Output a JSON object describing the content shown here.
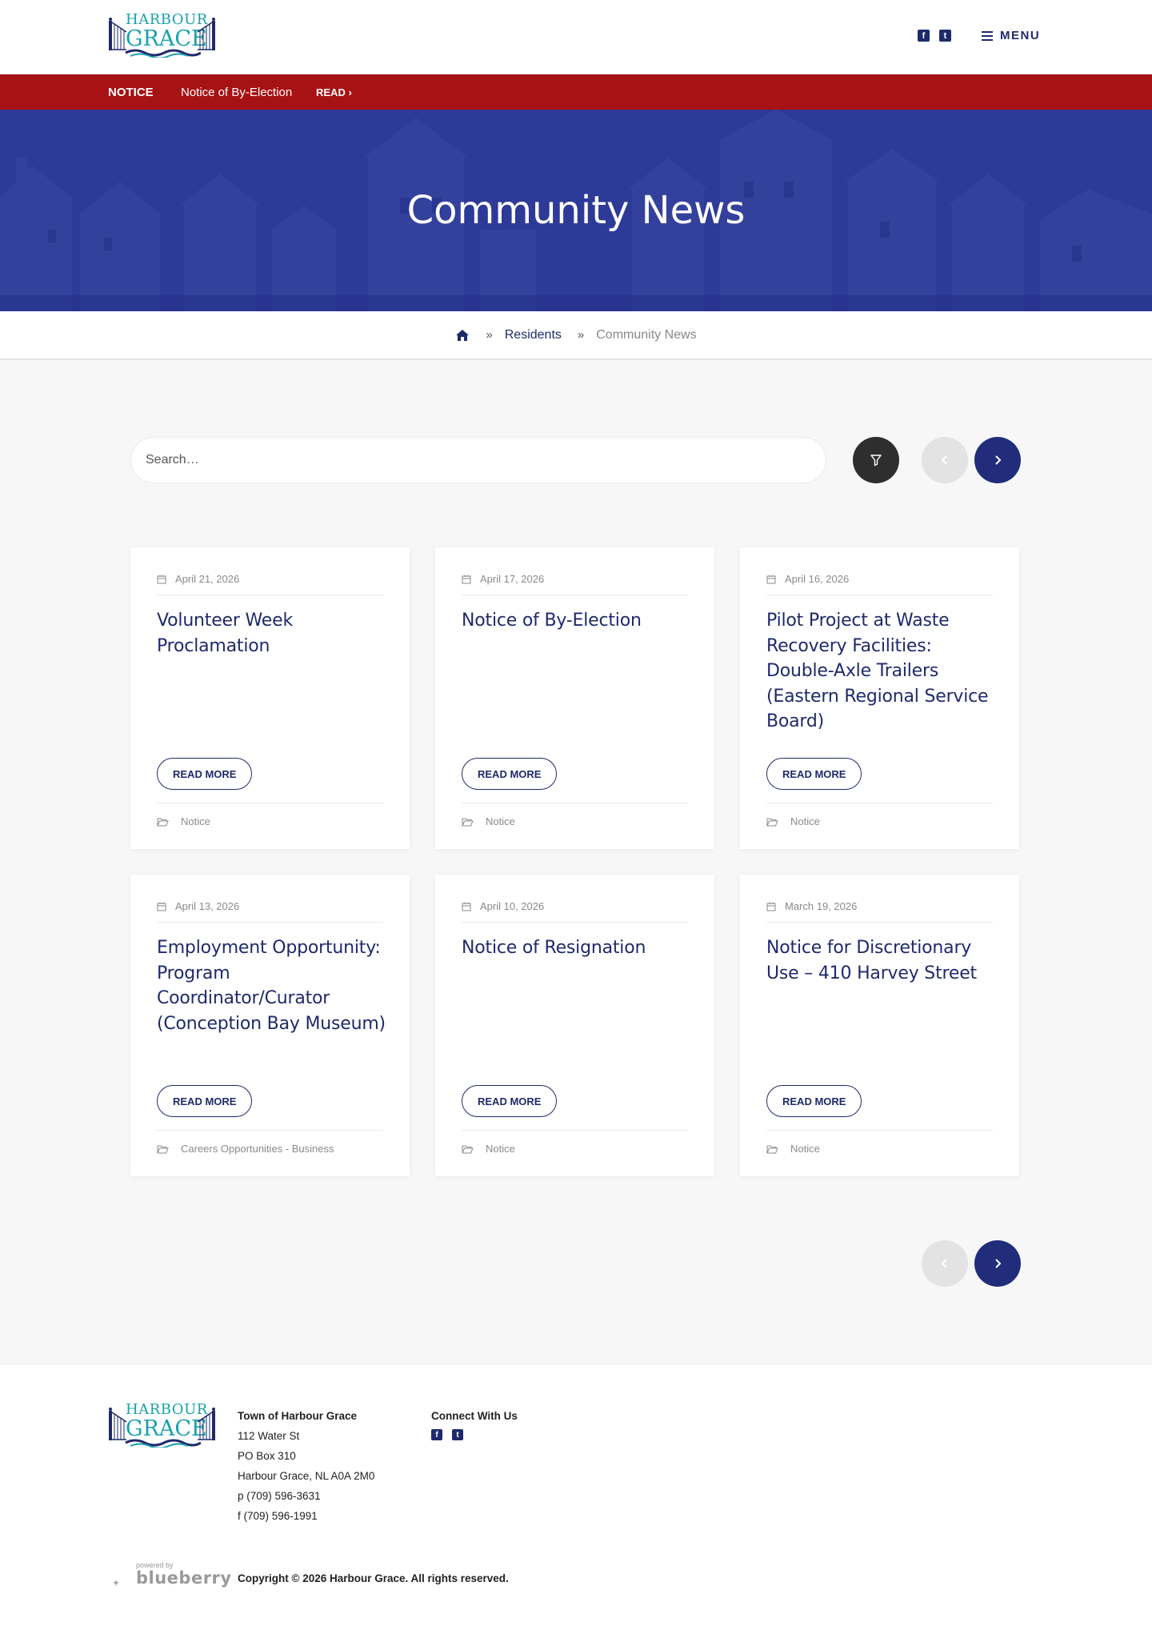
{
  "brand": {
    "logo_top": "HARBOUR",
    "logo_bottom": "GRACE",
    "accent": "#1aa0ad",
    "navy": "#1f2a6b"
  },
  "header": {
    "social": [
      {
        "icon": "facebook-icon",
        "glyph": "f"
      },
      {
        "icon": "twitter-icon",
        "glyph": "t"
      }
    ],
    "menu_label": "MENU"
  },
  "notice": {
    "label": "NOTICE",
    "text": "Notice of By-Election",
    "read_label": "READ ›",
    "color": "#a71214"
  },
  "hero": {
    "title": "Community News",
    "color": "#2d3a97"
  },
  "breadcrumb": {
    "home_icon": "home-icon",
    "separator": "»",
    "items": [
      "Residents",
      "Community News"
    ]
  },
  "search": {
    "placeholder": "Search…",
    "value": ""
  },
  "posts": [
    {
      "date": "April 21, 2026",
      "title": "Volunteer Week Proclamation",
      "button": "READ MORE",
      "category": "Notice"
    },
    {
      "date": "April 17, 2026",
      "title": "Notice of By-Election",
      "button": "READ MORE",
      "category": "Notice"
    },
    {
      "date": "April 16, 2026",
      "title": "Pilot Project at Waste Recovery Facilities: Double-Axle Trailers (Eastern Regional Service Board)",
      "button": "READ MORE",
      "category": "Notice"
    },
    {
      "date": "April 13, 2026",
      "title": "Employment Opportunity: Program Coordinator/Curator (Conception Bay Museum)",
      "button": "READ MORE",
      "category": "Careers Opportunities - Business"
    },
    {
      "date": "April 10, 2026",
      "title": "Notice of Resignation",
      "button": "READ MORE",
      "category": "Notice"
    },
    {
      "date": "March 19, 2026",
      "title": "Notice for Discretionary Use – 410 Harvey Street",
      "button": "READ MORE",
      "category": "Notice"
    }
  ],
  "footer": {
    "address": {
      "heading": "Town of Harbour Grace",
      "lines": [
        "112 Water St",
        "PO Box 310",
        "Harbour Grace, NL A0A 2M0",
        "p (709) 596-3631",
        "f (709) 596-1991"
      ]
    },
    "connect_heading": "Connect With Us",
    "powered_small": "powered by",
    "powered_brand": "blueberry",
    "copyright": "Copyright © 2026 Harbour Grace. All rights reserved."
  }
}
